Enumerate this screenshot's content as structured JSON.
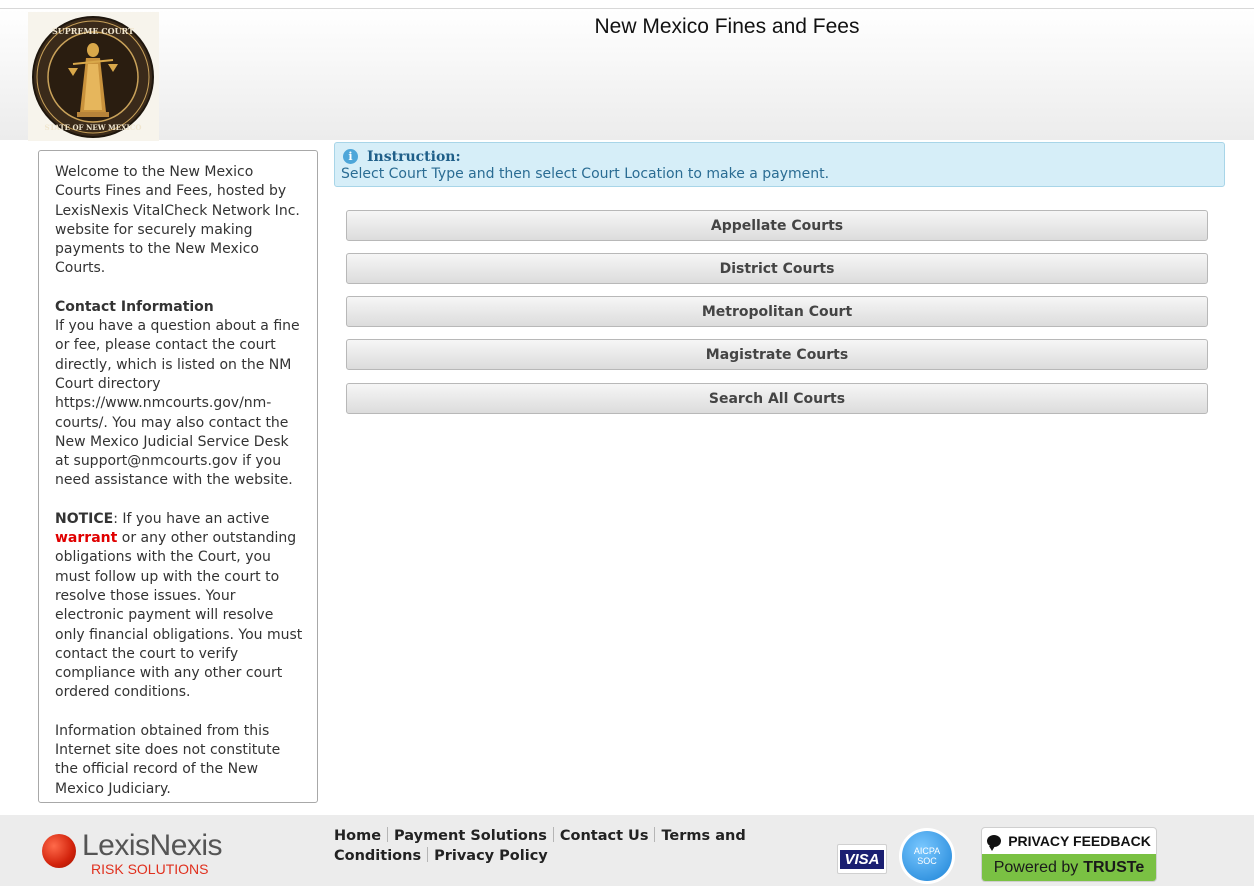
{
  "header": {
    "title": "New Mexico Fines and Fees",
    "seal": {
      "text_top": "SUPREME COURT",
      "text_bottom": "STATE OF NEW MEXICO"
    }
  },
  "sidebar": {
    "welcome": "Welcome to the New Mexico Courts Fines and Fees, hosted by LexisNexis VitalCheck Network Inc. website for securely making payments to the New Mexico Courts.",
    "contact_heading": "Contact Information",
    "contact_text": "If you have a question about a fine or fee, please contact the court directly, which is listed on the NM Court directory https://www.nmcourts.gov/nm-courts/. You may also contact the New Mexico Judicial Service Desk at support@nmcourts.gov if you need assistance with the website.",
    "notice_label": "NOTICE",
    "notice_pre": ": If you have an active ",
    "notice_warn": "warrant",
    "notice_post": " or any other outstanding obligations with the Court, you must follow up with the court to resolve those issues. Your electronic payment will resolve only financial obligations. You must contact the court to verify compliance with any other court ordered conditions.",
    "disclaimer": "Information obtained from this Internet site does not constitute the official record of the New Mexico Judiciary."
  },
  "instruction": {
    "label": "Instruction:",
    "text": "Select Court Type and then select Court Location to make a payment."
  },
  "courts": [
    {
      "label": "Appellate Courts"
    },
    {
      "label": "District Courts"
    },
    {
      "label": "Metropolitan Court"
    },
    {
      "label": "Magistrate Courts"
    },
    {
      "label": "Search All Courts"
    }
  ],
  "footer": {
    "logo_name": "LexisNexis",
    "logo_sub": "RISK SOLUTIONS",
    "links": {
      "home": "Home",
      "payment_solutions": "Payment Solutions",
      "contact_us": "Contact Us",
      "terms": "Terms and Conditions",
      "privacy": "Privacy Policy"
    },
    "visa": "VISA",
    "aicpa_line1": "AICPA",
    "aicpa_line2": "SOC",
    "privacy_feedback": "PRIVACY FEEDBACK",
    "powered_by": "Powered by",
    "truste": "TRUSTe"
  },
  "colors": {
    "warning": "#e00000",
    "instruction_bg": "#d6eef8",
    "instruction_text": "#2a6c93",
    "truste_green": "#7ac143",
    "lexis_red": "#e0301e"
  }
}
